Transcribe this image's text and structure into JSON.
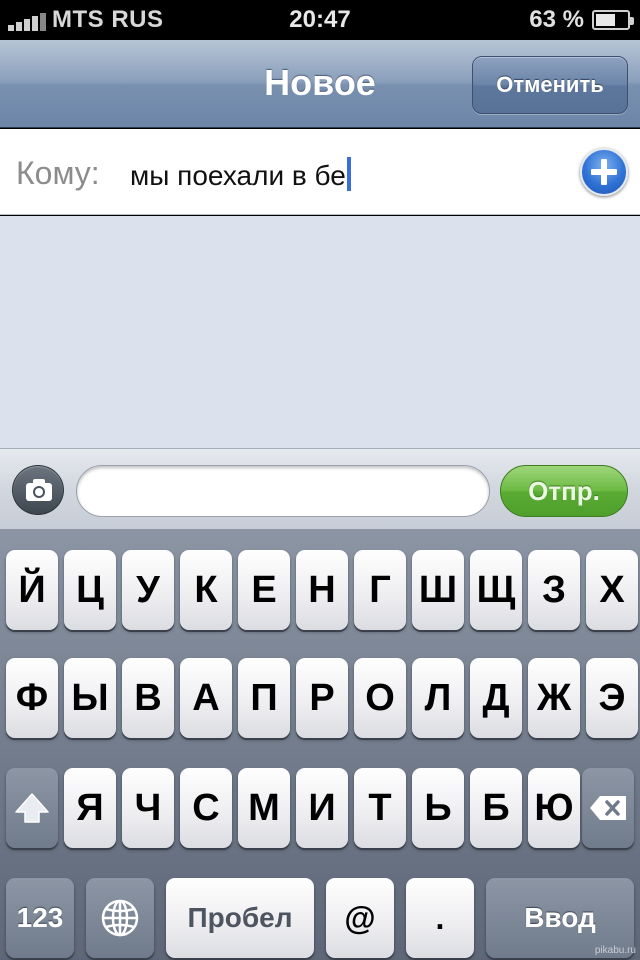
{
  "status_bar": {
    "carrier": "MTS RUS",
    "time": "20:47",
    "battery_percent_text": "63 %",
    "battery_level": 0.63
  },
  "navbar": {
    "title": "Новое",
    "cancel_label": "Отменить"
  },
  "to_field": {
    "label": "Кому:",
    "value": "мы поехали в бе"
  },
  "compose": {
    "message_value": "",
    "send_label": "Отпр."
  },
  "keyboard": {
    "row1": [
      "Й",
      "Ц",
      "У",
      "К",
      "Е",
      "Н",
      "Г",
      "Ш",
      "Щ",
      "З",
      "Х"
    ],
    "row2": [
      "Ф",
      "Ы",
      "В",
      "А",
      "П",
      "Р",
      "О",
      "Л",
      "Д",
      "Ж",
      "Э"
    ],
    "row3": [
      "Я",
      "Ч",
      "С",
      "М",
      "И",
      "Т",
      "Ь",
      "Б",
      "Ю"
    ],
    "numbers_label": "123",
    "space_label": "Пробел",
    "at_label": "@",
    "dot_label": ".",
    "return_label": "Ввод"
  },
  "watermark": "pikabu.ru",
  "icons": {
    "signal": "signal-bars-icon",
    "battery": "battery-icon",
    "add_contact": "plus-circle-icon",
    "camera": "camera-icon",
    "shift": "shift-arrow-icon",
    "backspace": "backspace-icon",
    "globe": "globe-icon"
  },
  "colors": {
    "navbar": "#7990af",
    "send_green": "#6cba42",
    "caret_blue": "#3a6fd8",
    "conversation_bg": "#dbe2ed"
  }
}
